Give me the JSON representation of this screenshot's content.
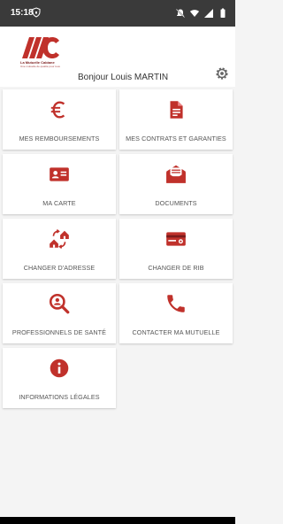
{
  "status_bar": {
    "time": "15:18",
    "left_icon": "shield-icon",
    "right_icons": [
      "no-notification-icon",
      "wifi-icon",
      "signal-icon",
      "battery-icon"
    ]
  },
  "header": {
    "logo_text": "La Mutuelle Cabiane",
    "logo_tagline": "Une mutuelle de qualité pour tous",
    "greeting": "Bonjour Louis MARTIN",
    "settings_icon": "gear-icon"
  },
  "tiles": [
    {
      "label": "MES REMBOURSEMENTS",
      "icon": "euro-icon"
    },
    {
      "label": "MES CONTRATS ET GARANTIES",
      "icon": "document-icon"
    },
    {
      "label": "MA CARTE",
      "icon": "id-card-icon"
    },
    {
      "label": "DOCUMENTS",
      "icon": "mail-icon"
    },
    {
      "label": "CHANGER D'ADRESSE",
      "icon": "change-address-icon"
    },
    {
      "label": "CHANGER DE RIB",
      "icon": "credit-card-icon"
    },
    {
      "label": "PROFESSIONNELS DE SANTÉ",
      "icon": "search-person-icon"
    },
    {
      "label": "CONTACTER MA MUTUELLE",
      "icon": "phone-icon"
    },
    {
      "label": "INFORMATIONS LÉGALES",
      "icon": "info-icon"
    }
  ],
  "colors": {
    "accent": "#c0312b",
    "status_bar": "#3a3a3a",
    "background": "#f4f4f4",
    "tile": "#ffffff",
    "label": "#555555"
  }
}
